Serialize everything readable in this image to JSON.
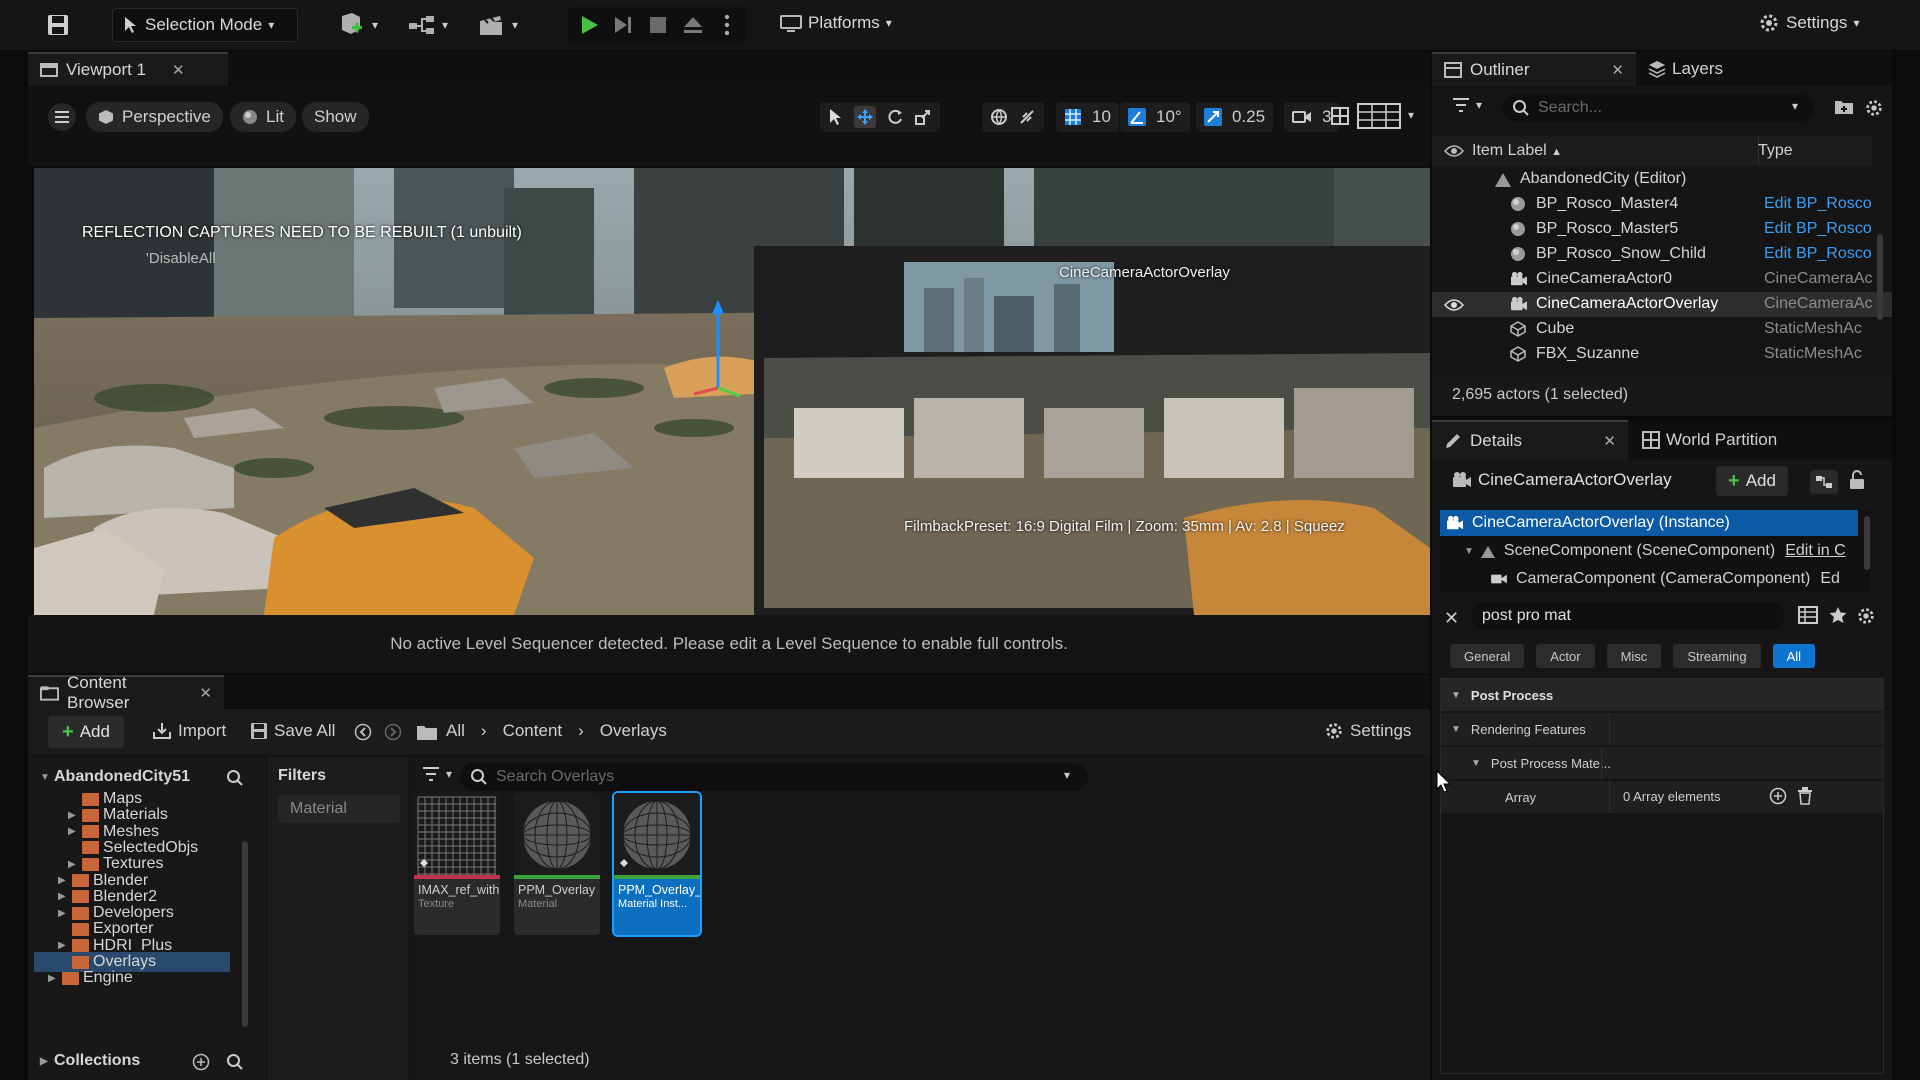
{
  "toolbar": {
    "mode_label": "Selection Mode",
    "platforms_label": "Platforms",
    "settings_label": "Settings"
  },
  "viewport": {
    "tab_label": "Viewport 1",
    "perspective_label": "Perspective",
    "lit_label": "Lit",
    "show_label": "Show",
    "grid_snap": "10",
    "rotation_snap": "10°",
    "scale_snap": "0.25",
    "camera_speed": "3",
    "overlay_message": "REFLECTION CAPTURES NEED TO BE REBUILT (1 unbuilt)",
    "overlay_sub": "'DisableAll",
    "pip_title": "CineCameraActorOverlay",
    "pip_footer": "FilmbackPreset: 16:9 Digital Film | Zoom: 35mm | Av: 2.8 | Squeez",
    "sequencer_message": "No active Level Sequencer detected. Please edit a Level Sequence to enable full controls."
  },
  "content_browser": {
    "tab_label": "Content Browser",
    "add_label": "Add",
    "import_label": "Import",
    "save_all_label": "Save All",
    "breadcrumb": [
      "All",
      "Content",
      "Overlays"
    ],
    "settings_label": "Settings",
    "root_label": "AbandonedCity51",
    "tree": [
      {
        "label": "Maps",
        "expandable": false
      },
      {
        "label": "Materials",
        "expandable": true
      },
      {
        "label": "Meshes",
        "expandable": true
      },
      {
        "label": "SelectedObjs",
        "expandable": false
      },
      {
        "label": "Textures",
        "expandable": true
      },
      {
        "label": "Blender",
        "expandable": true
      },
      {
        "label": "Blender2",
        "expandable": true
      },
      {
        "label": "Developers",
        "expandable": true
      },
      {
        "label": "Exporter",
        "expandable": false
      },
      {
        "label": "HDRI_Plus",
        "expandable": true
      },
      {
        "label": "Overlays",
        "expandable": false,
        "selected": true
      },
      {
        "label": "Engine",
        "expandable": true
      }
    ],
    "collections_label": "Collections",
    "filters_label": "Filters",
    "filter_chip": "Material",
    "search_placeholder": "Search Overlays",
    "assets": [
      {
        "name": "IMAX_ref_withSweet...",
        "type": "Texture",
        "selected": false
      },
      {
        "name": "PPM_Overlay",
        "type": "Material",
        "selected": false
      },
      {
        "name": "PPM_Overlay_Inst",
        "type": "Material Inst...",
        "selected": true
      }
    ],
    "status": "3 items (1 selected)"
  },
  "outliner": {
    "tab_label": "Outliner",
    "layers_label": "Layers",
    "search_placeholder": "Search...",
    "col_label": "Item Label",
    "col_type": "Type",
    "world_label": "AbandonedCity (Editor)",
    "rows": [
      {
        "name": "BP_Rosco_Master4",
        "type": "Edit BP_Rosco",
        "link": true,
        "icon": "blueprint-icon"
      },
      {
        "name": "BP_Rosco_Master5",
        "type": "Edit BP_Rosco",
        "link": true,
        "icon": "blueprint-icon"
      },
      {
        "name": "BP_Rosco_Snow_Child",
        "type": "Edit BP_Rosco",
        "link": true,
        "icon": "blueprint-icon"
      },
      {
        "name": "CineCameraActor0",
        "type": "CineCameraAc",
        "link": false,
        "icon": "camera-icon"
      },
      {
        "name": "CineCameraActorOverlay",
        "type": "CineCameraAc",
        "link": false,
        "icon": "camera-icon",
        "selected": true
      },
      {
        "name": "Cube",
        "type": "StaticMeshAc",
        "link": false,
        "icon": "mesh-icon"
      },
      {
        "name": "FBX_Suzanne",
        "type": "StaticMeshAc",
        "link": false,
        "icon": "mesh-icon"
      }
    ],
    "status": "2,695 actors (1 selected)"
  },
  "details": {
    "tab_label": "Details",
    "world_partition_label": "World Partition",
    "actor_name": "CineCameraActorOverlay",
    "add_label": "Add",
    "components": [
      {
        "label": "CineCameraActorOverlay (Instance)",
        "extra": ""
      },
      {
        "label": "SceneComponent (SceneComponent)",
        "extra": "Edit in C"
      },
      {
        "label": "CameraComponent (CameraComponent)",
        "extra": "Ed"
      }
    ],
    "search_value": "post pro mat",
    "filter_tabs": [
      "General",
      "Actor",
      "Misc",
      "Streaming",
      "All"
    ],
    "active_filter": "All",
    "sections": {
      "post_process": "Post Process",
      "rendering_features": "Rendering Features",
      "post_process_materials": "Post Process Mate...",
      "array_label": "Array",
      "array_value": "0 Array elements"
    }
  }
}
